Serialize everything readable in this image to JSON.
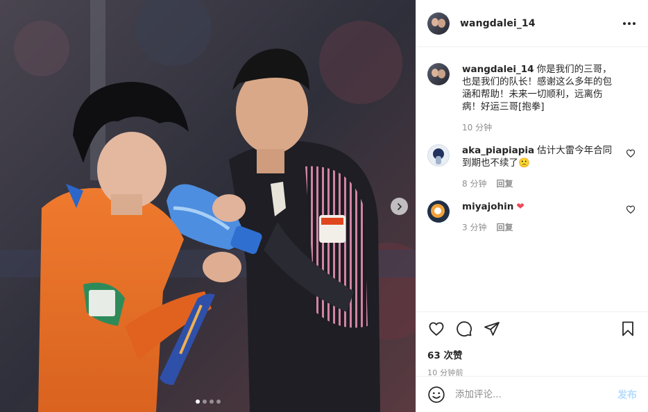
{
  "post": {
    "username": "wangdalei_14",
    "likes_text": "63 次赞",
    "time_text": "10 分钟前"
  },
  "carousel": {
    "slide_count": 4,
    "active_index": 0
  },
  "comments": [
    {
      "user": "wangdalei_14",
      "text": "你是我们的三哥，也是我们的队长！感谢这么多年的包涵和帮助！未来一切顺利，远离伤病！好运三哥[抱拳]",
      "time": "10 分钟",
      "reply": "",
      "likeable": false
    },
    {
      "user": "aka_piapiapia",
      "text": "估计大雷今年合同到期也不续了🙁",
      "time": "8 分钟",
      "reply": "回复",
      "likeable": true
    },
    {
      "user": "miyajohin",
      "text": "❤",
      "time": "3 分钟",
      "reply": "回复",
      "likeable": true
    }
  ],
  "add_comment": {
    "placeholder": "添加评论...",
    "post_label": "发布"
  },
  "icons": {
    "like": "heart-icon",
    "comment": "comment-icon",
    "share": "paper-plane-icon",
    "save": "bookmark-icon",
    "emoji": "emoji-icon",
    "more": "more-horizontal-icon",
    "next": "chevron-right-icon"
  },
  "colors": {
    "text": "#262626",
    "secondary": "#8e8e8e",
    "border": "#efefef",
    "post_button": "#b3dbff",
    "heart_red": "#ed4956"
  }
}
